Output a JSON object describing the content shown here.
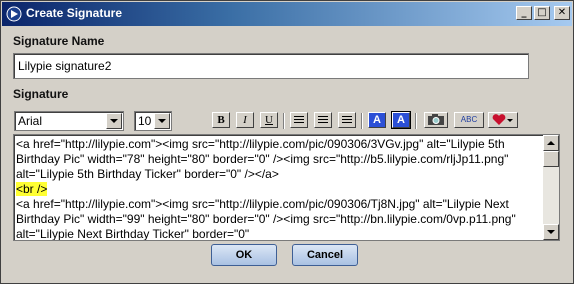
{
  "window": {
    "title": "Create Signature",
    "controls": {
      "minimize": "_",
      "maximize": "□",
      "close": "✕"
    }
  },
  "form": {
    "name_label": "Signature Name",
    "name_value": "Lilypie signature2",
    "signature_label": "Signature"
  },
  "toolbar": {
    "font_value": "Arial",
    "size_value": "10",
    "bold_label": "B",
    "italic_label": "I",
    "underline_label": "U",
    "text_color_label": "A",
    "highlight_label": "A",
    "spell_label": "ABC",
    "icons": [
      "align-left-icon",
      "align-center-icon",
      "align-right-icon",
      "camera-icon",
      "spell-check-icon",
      "heart-icon"
    ]
  },
  "editor": {
    "lines": [
      "<a href=\"http://lilypie.com\"><img src=\"http://lilypie.com/pic/090306/3VGv.jpg\" alt=\"Lilypie 5th Birthday Pic\" width=\"78\" height=\"80\" border=\"0\" /><img src=\"http://b5.lilypie.com/rljJp11.png\" alt=\"Lilypie 5th Birthday Ticker\" border=\"0\"  /></a>",
      "<br />",
      "<a href=\"http://lilypie.com\"><img src=\"http://lilypie.com/pic/090306/Tj8N.jpg\" alt=\"Lilypie Next Birthday Pic\" width=\"99\" height=\"80\" border=\"0\" /><img src=\"http://bn.lilypie.com/0vp.p11.png\" alt=\"Lilypie Next Birthday Ticker\" border=\"0\""
    ]
  },
  "buttons": {
    "ok": "OK",
    "cancel": "Cancel"
  },
  "colors": {
    "titlebar_start": "#0a246a",
    "highlight": "#ffff33",
    "text_color_btn": "#2b4fd6"
  }
}
